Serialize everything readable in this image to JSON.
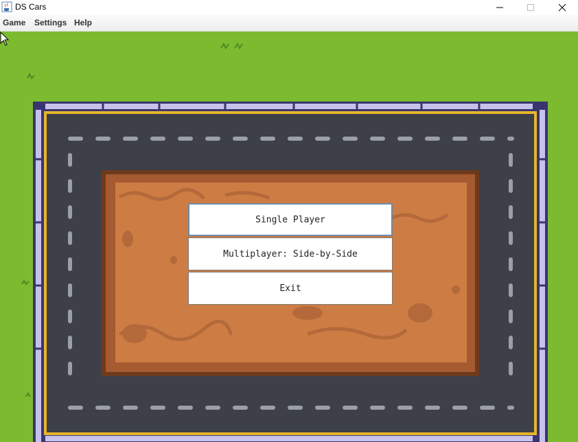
{
  "window": {
    "title": "DS Cars",
    "app_icon": "java-cup-icon",
    "controls": [
      "minimize-icon",
      "maximize-icon",
      "close-icon"
    ]
  },
  "menubar": {
    "items": [
      {
        "label": "Game"
      },
      {
        "label": "Settings"
      },
      {
        "label": "Help"
      }
    ]
  },
  "main_menu": {
    "buttons": [
      {
        "label": "Single Player",
        "focused": true
      },
      {
        "label": "Multiplayer: Side-by-Side"
      },
      {
        "label": "Exit"
      }
    ]
  },
  "colors": {
    "grass": "#7cbb2f",
    "asphalt": "#3d4047",
    "lane_marks": "#9aa0a6",
    "dirt": "#cd7c44",
    "dirt_border": "#6e3a1c",
    "curb_yellow": "#e8b62a",
    "rail_stone": "#b8b3e0"
  }
}
